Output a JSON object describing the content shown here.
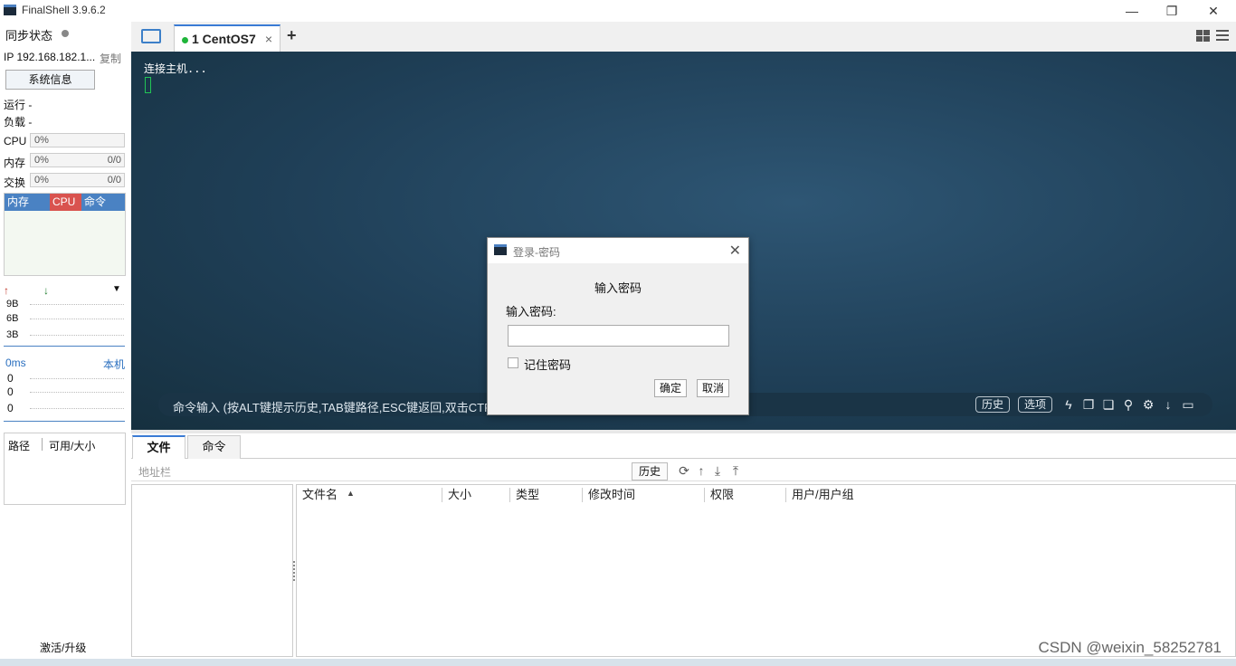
{
  "window": {
    "title": "FinalShell 3.9.6.2",
    "minimize": "—",
    "maximize": "❐",
    "close": "✕"
  },
  "sidebar": {
    "sync_status": "同步状态",
    "ip": "IP 192.168.182.1...",
    "copy": "复制",
    "sysinfo_button": "系统信息",
    "run_label": "运行 -",
    "load_label": "负载 -",
    "cpu_label": "CPU",
    "cpu_value": "0%",
    "mem_label": "内存",
    "mem_value": "0%",
    "mem_ratio": "0/0",
    "swap_label": "交换",
    "swap_value": "0%",
    "swap_ratio": "0/0",
    "proc_headers": [
      "内存",
      "CPU",
      "命令"
    ],
    "net_up_icon": "arrow-up-icon",
    "net_down_icon": "arrow-down-icon",
    "net_values": [
      "9B",
      "6B",
      "3B"
    ],
    "latency": "0ms",
    "latency_host": "本机",
    "latency_values": [
      "0",
      "0",
      "0"
    ],
    "path_header": "路径",
    "avail_header": "可用/大小",
    "activate": "激活/升级"
  },
  "tabs": {
    "session_tab": "1 CentOS7",
    "close": "×",
    "add": "+"
  },
  "terminal": {
    "connecting": "连接主机...",
    "cmd_hint": "命令输入 (按ALT键提示历史,TAB键路径,ESC键返回,双击CTR",
    "history_btn": "历史",
    "options_btn": "选项"
  },
  "dialog": {
    "title": "登录-密码",
    "heading": "输入密码",
    "password_label": "输入密码:",
    "password_value": "",
    "remember": "记住密码",
    "ok": "确定",
    "cancel": "取消"
  },
  "files": {
    "tab_files": "文件",
    "tab_commands": "命令",
    "address_placeholder": "地址栏",
    "history_btn": "历史",
    "columns": [
      "文件名",
      "大小",
      "类型",
      "修改时间",
      "权限",
      "用户/用户组"
    ],
    "sort_icon": "▲"
  },
  "watermark": "CSDN @weixin_58252781"
}
